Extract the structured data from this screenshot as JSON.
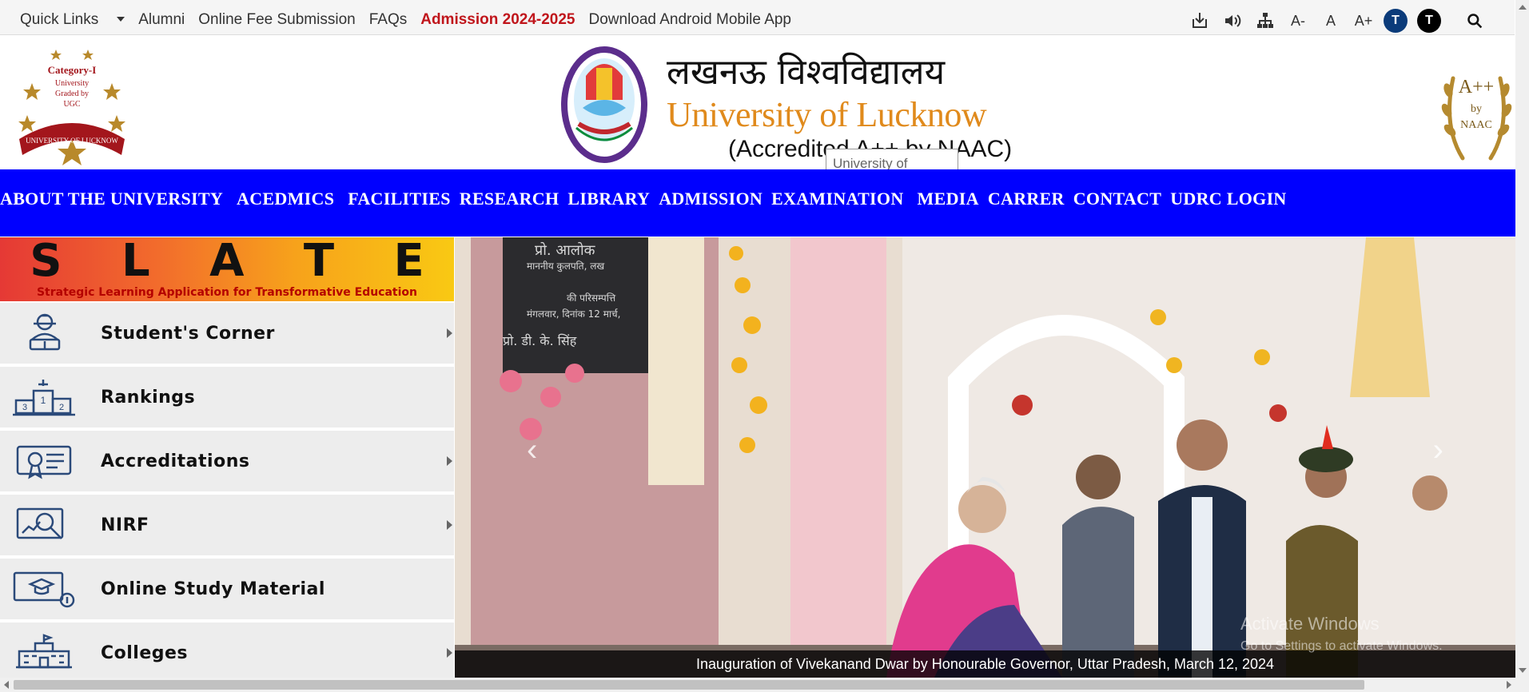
{
  "topbar": {
    "links": [
      "Quick Links",
      "Alumni",
      "Online Fee Submission",
      "FAQs",
      "Admission 2024-2025",
      "Download Android Mobile App"
    ],
    "font_decrease": "A-",
    "font_normal": "A",
    "font_increase": "A+",
    "theme_dark_label": "T",
    "theme_black_label": "T",
    "colors": {
      "admission": "#c0151b",
      "theme_dark": "#0b3b7a",
      "theme_black": "#000000"
    }
  },
  "header": {
    "left_badge": {
      "line1": "Category-I",
      "line2": "University",
      "line3": "Graded by",
      "line4": "UGC",
      "ribbon": "UNIVERSITY OF LUCKNOW"
    },
    "title_hindi": "लखनऊ विश्वविद्यालय",
    "title_english": "University of Lucknow",
    "accredited": "(Accredited A++ by NAAC)",
    "tooltip": "University of Lucknow",
    "right_badge": {
      "line1": "A++",
      "line2": "by",
      "line3": "NAAC"
    }
  },
  "nav": {
    "items": [
      "ABOUT THE UNIVERSITY",
      "ACEDMICS",
      "FACILITIES",
      "RESEARCH",
      "LIBRARY",
      "ADMISSION",
      "EXAMINATION",
      "MEDIA",
      "CARRER",
      "CONTACT",
      "UDRC LOGIN"
    ],
    "background": "#0000ff"
  },
  "slate": {
    "letters": [
      "S",
      "L",
      "A",
      "T",
      "E"
    ],
    "subtitle": "Strategic Learning Application for Transformative Education"
  },
  "sidebar": {
    "items": [
      {
        "label": "Student's Corner",
        "icon": "student-icon",
        "has_arrow": true
      },
      {
        "label": "Rankings",
        "icon": "podium-icon",
        "has_arrow": false
      },
      {
        "label": "Accreditations",
        "icon": "certificate-icon",
        "has_arrow": true
      },
      {
        "label": "NIRF",
        "icon": "nirf-icon",
        "has_arrow": true
      },
      {
        "label": "Online Study Material",
        "icon": "study-material-icon",
        "has_arrow": false
      },
      {
        "label": "Colleges",
        "icon": "college-icon",
        "has_arrow": true
      }
    ]
  },
  "carousel": {
    "caption": "Inauguration of Vivekanand Dwar by Honourable Governor, Uttar Pradesh, March 12, 2024",
    "plaque_line1": "प्रो. आलोक",
    "plaque_line2": "माननीय कुलपति, लख",
    "plaque_line3": "की परिसम्पत्ति",
    "plaque_line4": "मंगलवार, दिनांक 12 मार्च,",
    "plaque_line5": "प्रो. डी. के. सिंह"
  },
  "watermark": {
    "line1": "Activate Windows",
    "line2": "Go to Settings to activate Windows."
  }
}
